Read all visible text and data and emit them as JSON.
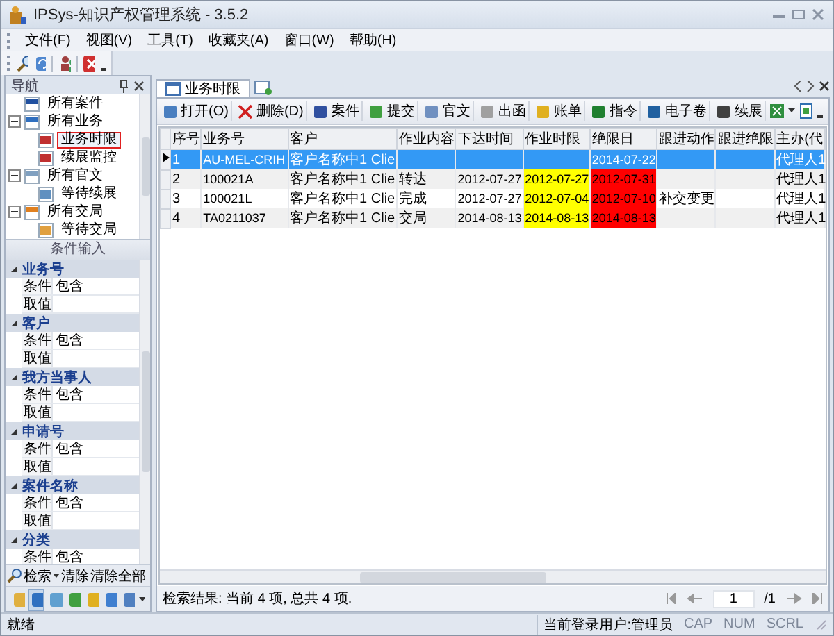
{
  "window": {
    "title": "IPSys-知识产权管理系统 - 3.5.2"
  },
  "menu": [
    "文件(F)",
    "视图(V)",
    "工具(T)",
    "收藏夹(A)",
    "窗口(W)",
    "帮助(H)"
  ],
  "nav": {
    "title": "导航",
    "tree": [
      {
        "label": "所有案件",
        "selected": false
      },
      {
        "label": "所有业务",
        "selected": false,
        "expanded": true,
        "children": [
          {
            "label": "业务时限",
            "selected": true
          },
          {
            "label": "续展监控",
            "selected": false
          }
        ]
      },
      {
        "label": "所有官文",
        "selected": false,
        "expanded": true,
        "children": [
          {
            "label": "等待续展",
            "selected": false
          }
        ]
      },
      {
        "label": "所有交局",
        "selected": false,
        "expanded": true,
        "children": [
          {
            "label": "等待交局",
            "selected": false
          }
        ]
      }
    ]
  },
  "conditions": {
    "title": "条件输入",
    "groups": [
      {
        "name": "业务号",
        "expanded": true,
        "fields": [
          {
            "label": "条件",
            "value": "包含"
          },
          {
            "label": "取值"
          }
        ]
      },
      {
        "name": "客户",
        "expanded": true,
        "fields": [
          {
            "label": "条件",
            "value": "包含"
          },
          {
            "label": "取值"
          }
        ]
      },
      {
        "name": "我方当事人",
        "expanded": true,
        "fields": [
          {
            "label": "条件",
            "value": "包含"
          },
          {
            "label": "取值"
          }
        ]
      },
      {
        "name": "申请号",
        "expanded": true,
        "fields": [
          {
            "label": "条件",
            "value": "包含"
          },
          {
            "label": "取值"
          }
        ]
      },
      {
        "name": "案件名称",
        "expanded": true,
        "fields": [
          {
            "label": "条件",
            "value": "包含"
          },
          {
            "label": "取值"
          }
        ]
      },
      {
        "name": "分类",
        "expanded": true,
        "fields": [
          {
            "label": "条件",
            "value": "包含"
          }
        ]
      }
    ]
  },
  "search_actions": [
    "检索",
    "清除",
    "清除全部"
  ],
  "tabs": [
    {
      "label": "业务时限",
      "selected": true
    }
  ],
  "toolbar": [
    "打开(O)",
    "删除(D)",
    "案件",
    "提交",
    "官文",
    "出函",
    "账单",
    "指令",
    "电子卷",
    "续展"
  ],
  "table": {
    "columns": [
      "序号",
      "业务号",
      "客户",
      "作业内容",
      "下达时间",
      "作业时限",
      "绝限日",
      "跟进动作",
      "跟进绝限",
      "主办(代"
    ],
    "rows": [
      {
        "selected": true,
        "cells": [
          {
            "text": "1"
          },
          {
            "text": "AU-MEL-CRIH"
          },
          {
            "text": "客户名称中1 Clie"
          },
          {},
          {},
          {},
          {
            "text": "2014-07-22"
          },
          {},
          {},
          {
            "text": "代理人1"
          }
        ]
      },
      {
        "selected": false,
        "cells": [
          {
            "text": "2"
          },
          {
            "text": "100021A"
          },
          {
            "text": "客户名称中1 Clie"
          },
          {
            "text": "转达"
          },
          {
            "text": "2012-07-27"
          },
          {
            "text": "2012-07-27",
            "color": "#ffff00"
          },
          {
            "text": "2012-07-31",
            "color": "#ff0000"
          },
          {},
          {},
          {
            "text": "代理人1"
          }
        ]
      },
      {
        "selected": false,
        "cells": [
          {
            "text": "3"
          },
          {
            "text": "100021L"
          },
          {
            "text": "客户名称中1 Clie"
          },
          {
            "text": "完成"
          },
          {
            "text": "2012-07-27"
          },
          {
            "text": "2012-07-04",
            "color": "#ffff00"
          },
          {
            "text": "2012-07-10",
            "color": "#ff0000"
          },
          {
            "text": "补交变更"
          },
          {},
          {
            "text": "代理人1"
          }
        ]
      },
      {
        "selected": false,
        "cells": [
          {
            "text": "4"
          },
          {
            "text": "TA0211037"
          },
          {
            "text": "客户名称中1 Clie"
          },
          {
            "text": "交局"
          },
          {
            "text": "2014-08-13"
          },
          {
            "text": "2014-08-13",
            "color": "#ffff00"
          },
          {
            "text": "2014-08-13",
            "color": "#ff0000"
          },
          {},
          {},
          {
            "text": "代理人1"
          }
        ]
      }
    ]
  },
  "result": "检索结果: 当前 4 项, 总共 4 项.",
  "pager": {
    "page": "1",
    "total": "/1"
  },
  "status_bar": {
    "text": "就绪",
    "user": "当前登录用户:管理员",
    "indicators": [
      {
        "label": "CAP",
        "on": false
      },
      {
        "label": "NUM",
        "on": false
      },
      {
        "label": "SCRL",
        "on": false
      }
    ]
  }
}
